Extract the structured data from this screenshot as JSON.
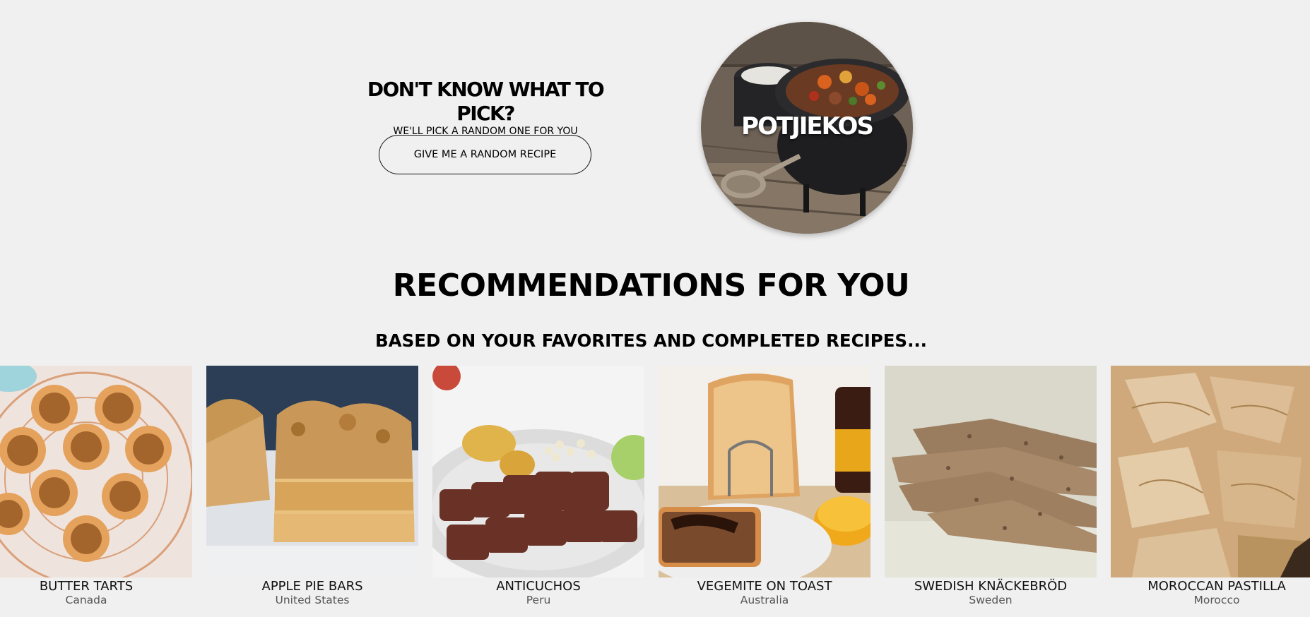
{
  "random": {
    "heading": "DON'T KNOW WHAT TO PICK?",
    "subheading": "WE'LL PICK A RANDOM ONE FOR YOU",
    "button_label": "GIVE ME A RANDOM RECIPE"
  },
  "featured": {
    "title": "POTJIEKOS"
  },
  "recommendations": {
    "title": "RECOMMENDATIONS FOR YOU",
    "subtitle": "BASED ON YOUR FAVORITES AND COMPLETED RECIPES..."
  },
  "cards": [
    {
      "name": "BUTTER TARTS",
      "country": "Canada"
    },
    {
      "name": "APPLE PIE BARS",
      "country": "United States"
    },
    {
      "name": "ANTICUCHOS",
      "country": "Peru"
    },
    {
      "name": "VEGEMITE ON TOAST",
      "country": "Australia"
    },
    {
      "name": "SWEDISH KNÄCKEBRÖD",
      "country": "Sweden"
    },
    {
      "name": "MOROCCAN PASTILLA",
      "country": "Morocco"
    }
  ],
  "colors": {
    "background": "#f0f0f0",
    "text": "#111111",
    "muted_text": "#555555"
  }
}
